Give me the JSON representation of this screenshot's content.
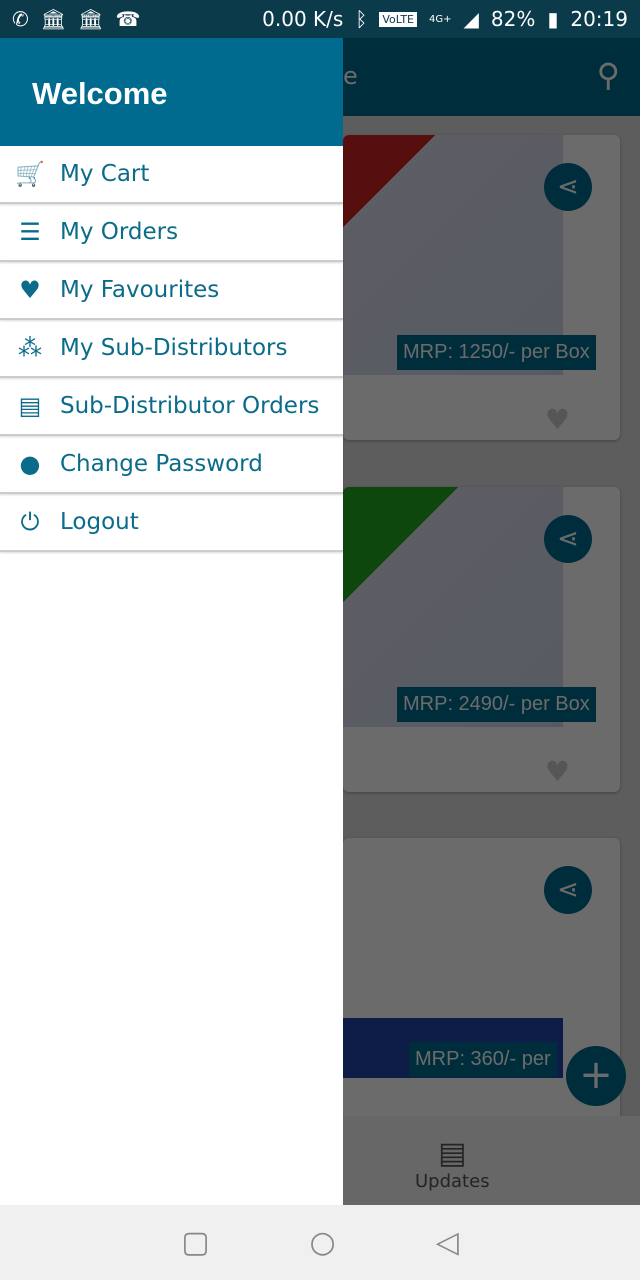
{
  "status_bar": {
    "speed": "0.00 K/s",
    "volte": "VoLTE",
    "network": "4G+",
    "battery": "82%",
    "time": "20:19"
  },
  "app_bar": {
    "title_fragment": "e"
  },
  "products": [
    {
      "mrp": "MRP: 1250/- per Box"
    },
    {
      "mrp": "MRP: 2490/- per Box"
    },
    {
      "mrp": "MRP: 360/- per"
    }
  ],
  "bottom_nav": {
    "updates": "Updates"
  },
  "drawer": {
    "header": "Welcome",
    "items": [
      {
        "label": "My Cart",
        "icon": "cart-icon"
      },
      {
        "label": "My Orders",
        "icon": "list-icon"
      },
      {
        "label": "My Favourites",
        "icon": "heart-icon"
      },
      {
        "label": "My Sub-Distributors",
        "icon": "group-icon"
      },
      {
        "label": "Sub-Distributor Orders",
        "icon": "receipt-icon"
      },
      {
        "label": "Change Password",
        "icon": "account-icon"
      },
      {
        "label": "Logout",
        "icon": "power-icon"
      }
    ]
  },
  "colors": {
    "primary": "#006b8f",
    "status": "#0b3a4a"
  }
}
